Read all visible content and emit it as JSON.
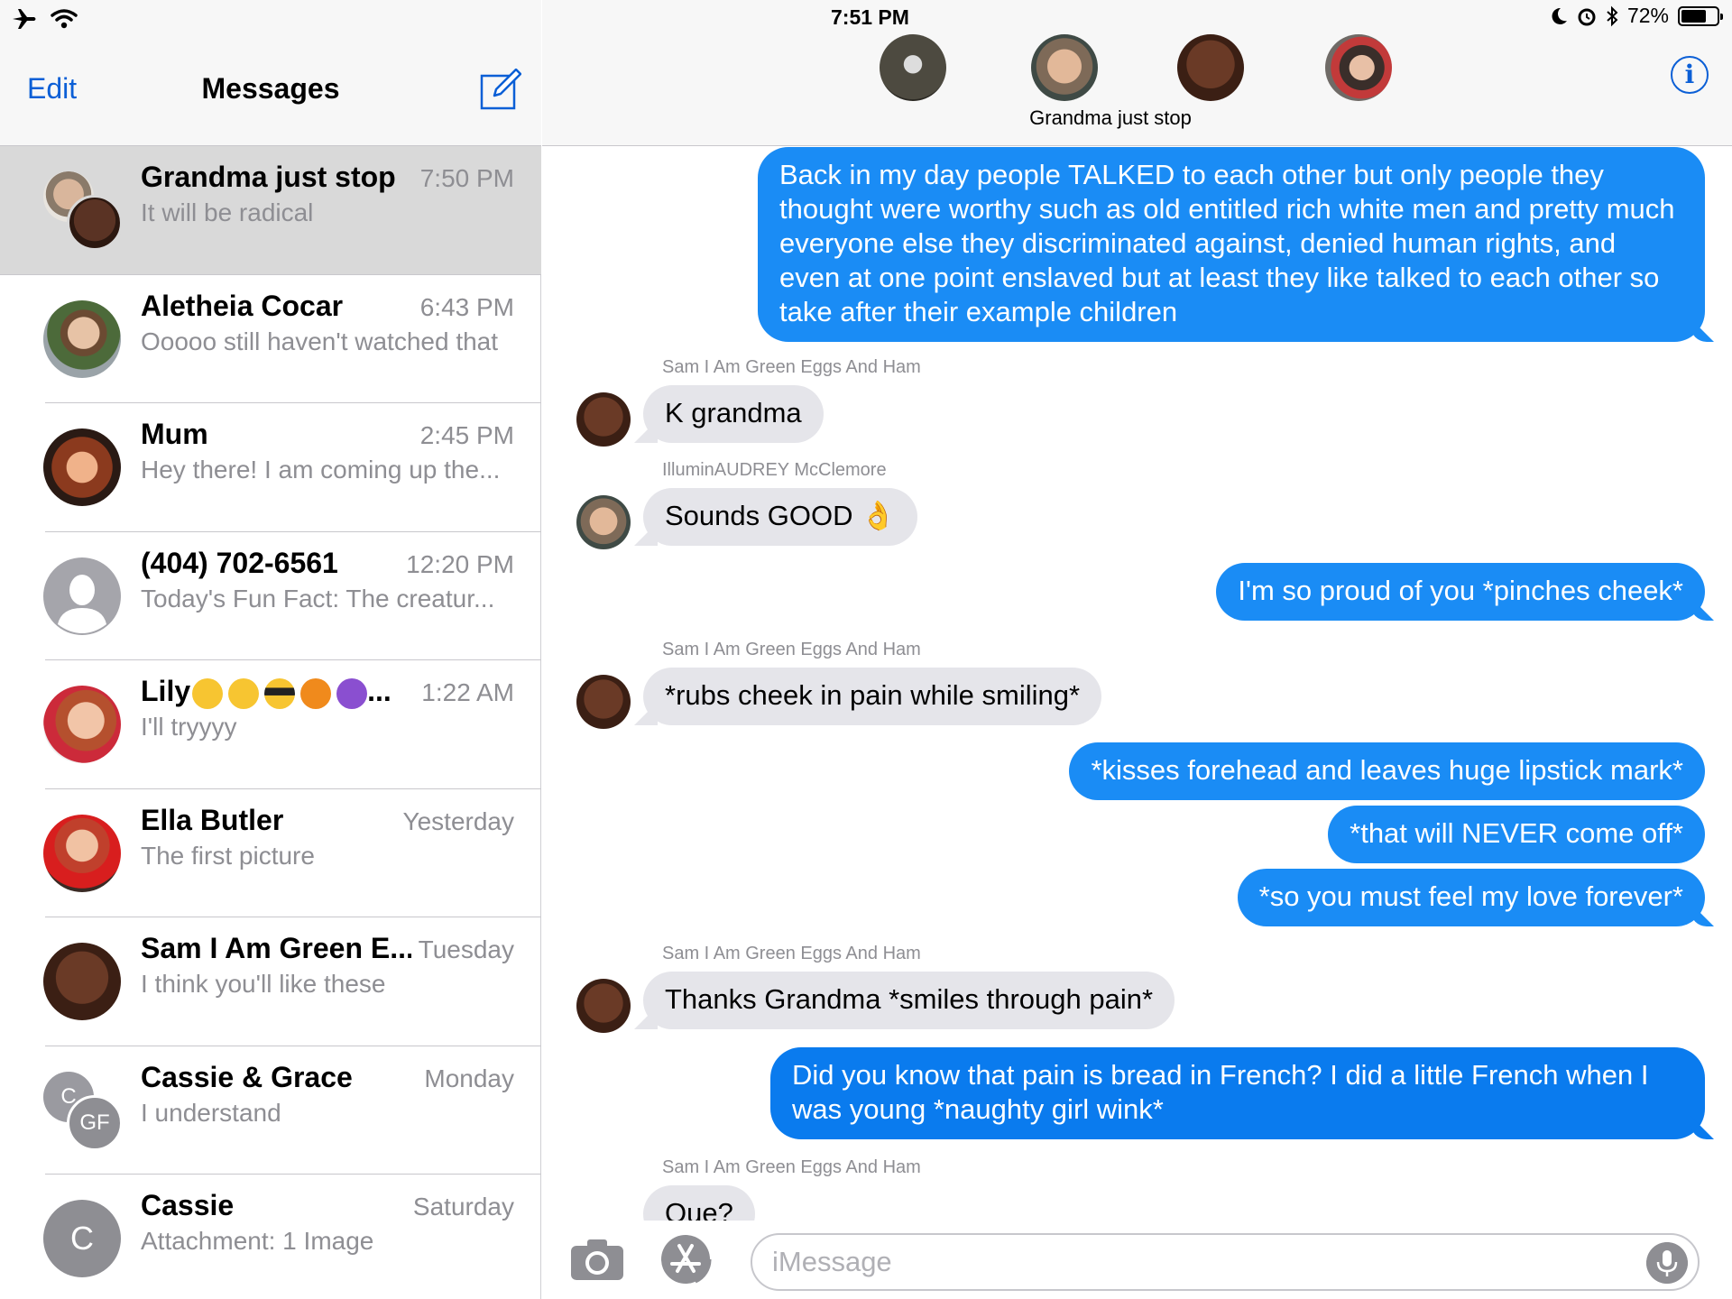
{
  "status_bar": {
    "time": "7:51 PM",
    "battery_percent": "72%",
    "battery_level": 0.72
  },
  "sidebar": {
    "edit_label": "Edit",
    "title": "Messages",
    "conversations": [
      {
        "name": "Grandma just stop",
        "time": "7:50 PM",
        "preview": "It will be radical",
        "selected": true
      },
      {
        "name": "Aletheia Cocar",
        "time": "6:43 PM",
        "preview": "Ooooo still haven't watched that"
      },
      {
        "name": "Mum",
        "time": "2:45 PM",
        "preview": "Hey there! I am coming up the..."
      },
      {
        "name": "(404) 702-6561",
        "time": "12:20 PM",
        "preview": "Today's Fun Fact: The creatur..."
      },
      {
        "name": "Lily",
        "name_suffix": "...",
        "time": "1:22 AM",
        "preview": "I'll tryyyy"
      },
      {
        "name": "Ella Butler",
        "time": "Yesterday",
        "preview": "The first picture"
      },
      {
        "name": "Sam I Am Green E...",
        "time": "Tuesday",
        "preview": "I think you'll like these"
      },
      {
        "name": "Cassie & Grace",
        "time": "Monday",
        "preview": "I understand",
        "initials_a": "C",
        "initials_b": "GF"
      },
      {
        "name": "Cassie",
        "time": "Saturday",
        "preview": "Attachment: 1 Image",
        "initials": "C"
      }
    ]
  },
  "thread": {
    "group_name": "Grandma just stop",
    "messages": [
      {
        "text": "Back in my day people TALKED to each other but only people they thought were worthy such as old entitled rich white men and pretty much everyone else they discriminated against, denied human rights, and even at one point enslaved but at least they like talked to each other so take after their example children"
      },
      {
        "sender": "Sam I Am Green Eggs And Ham",
        "text": "K grandma"
      },
      {
        "sender": "IlluminAUDREY McClemore",
        "text": "Sounds GOOD 👌"
      },
      {
        "text": "I'm so proud of you *pinches cheek*"
      },
      {
        "sender": "Sam I Am Green Eggs And Ham",
        "text": "*rubs cheek in pain while smiling*"
      },
      {
        "text": "*kisses forehead and leaves huge lipstick mark*"
      },
      {
        "text": "*that will NEVER come off*"
      },
      {
        "text": "*so you must feel my love forever*"
      },
      {
        "sender": "Sam I Am Green Eggs And Ham",
        "text": "Thanks Grandma *smiles through pain*"
      },
      {
        "text": "Did you know that pain is bread in French? I did a little French when I was young *naughty girl wink*"
      },
      {
        "sender": "Sam I Am Green Eggs And Ham",
        "text": "Que?"
      }
    ]
  },
  "composer": {
    "placeholder": "iMessage"
  },
  "colors": {
    "accent": "#0b5fd6",
    "outgoing_bubble": "#1a8cf5",
    "incoming_bubble": "#e5e5ea",
    "selected_row": "#d9d9d9"
  }
}
